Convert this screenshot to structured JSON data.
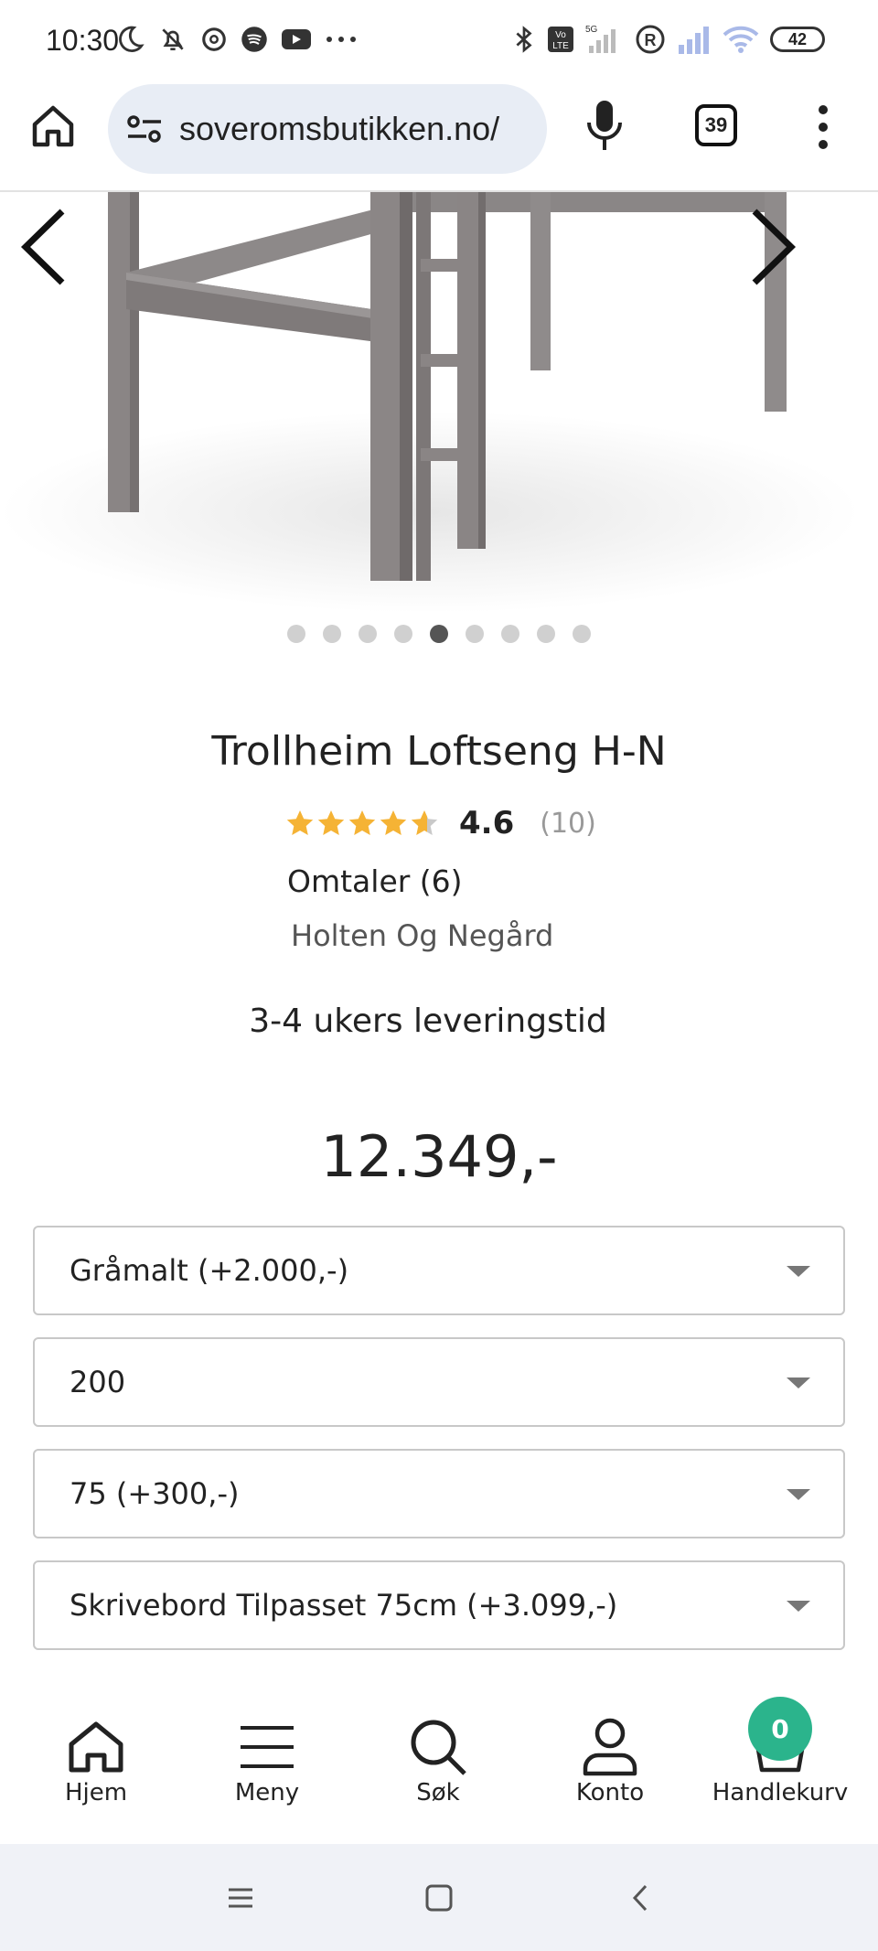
{
  "status_bar": {
    "time": "10:30",
    "battery": "42",
    "icons": [
      "moon-icon",
      "bell-muted-icon",
      "threads-icon",
      "spotify-icon",
      "youtube-icon",
      "more-icon",
      "bluetooth-icon",
      "volte-icon",
      "signal-5g-icon",
      "registered-icon",
      "signal-icon",
      "wifi-icon",
      "battery-icon"
    ]
  },
  "browser": {
    "url": "soveromsbutikken.no/",
    "tab_count": "39",
    "icons": [
      "home-icon",
      "site-settings-icon",
      "mic-icon",
      "tabs-icon",
      "kebab-menu-icon"
    ]
  },
  "gallery": {
    "dot_count": 9,
    "active_dot": 4,
    "icons": [
      "chevron-left-icon",
      "chevron-right-icon"
    ]
  },
  "product": {
    "title": "Trollheim Loftseng H-N",
    "rating": 4.6,
    "rating_display": "4.6",
    "rating_count": "(10)",
    "reviews": "Omtaler (6)",
    "brand": "Holten Og Negård",
    "delivery": "3-4 ukers leveringstid",
    "price": "12.349,-"
  },
  "options": [
    {
      "value": "Gråmalt (+2.000,-)"
    },
    {
      "value": "200"
    },
    {
      "value": "75 (+300,-)"
    },
    {
      "value": "Skrivebord Tilpasset 75cm (+3.099,-)"
    }
  ],
  "bottom_nav": {
    "items": [
      {
        "label": "Hjem",
        "icon": "home-icon"
      },
      {
        "label": "Meny",
        "icon": "hamburger-icon"
      },
      {
        "label": "Søk",
        "icon": "search-icon"
      },
      {
        "label": "Konto",
        "icon": "user-icon"
      },
      {
        "label": "Handlekurv",
        "icon": "cart-icon"
      }
    ],
    "cart_count": "0"
  },
  "colors": {
    "accent": "#2bb48c",
    "star": "#f5b335",
    "url_bg": "#e8edf5"
  }
}
